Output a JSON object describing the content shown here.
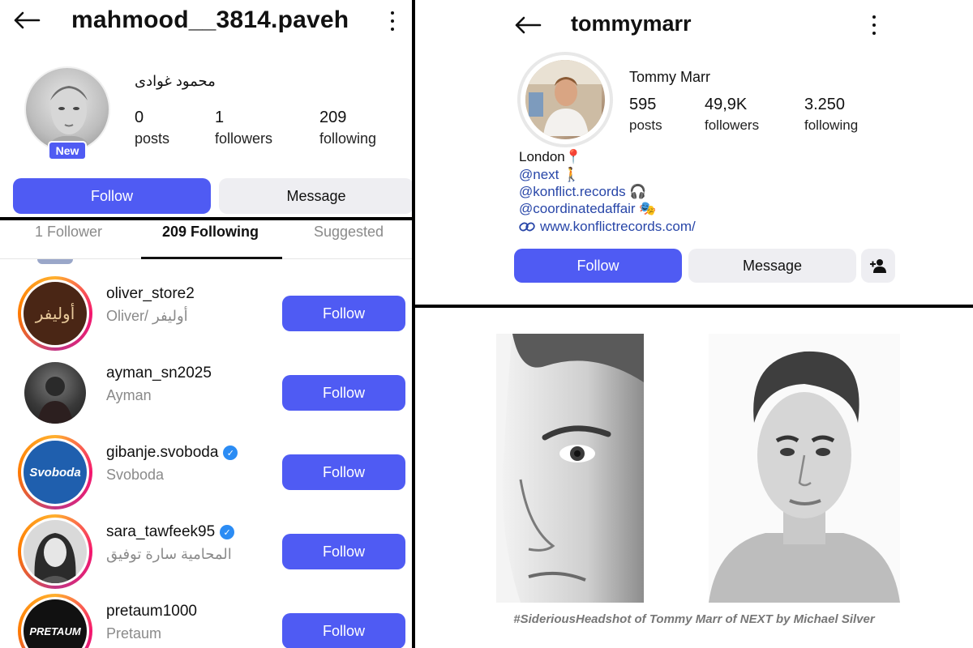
{
  "top_left": {
    "username": "mahmood__3814.paveh",
    "display_name": "محمود غوادی",
    "badge": "New",
    "stats": [
      {
        "value": "0",
        "label": "posts"
      },
      {
        "value": "1",
        "label": "followers"
      },
      {
        "value": "209",
        "label": "following"
      }
    ],
    "follow_label": "Follow",
    "message_label": "Message"
  },
  "bottom_left": {
    "tabs": [
      "1 Follower",
      "209 Following",
      "Suggested"
    ],
    "active_tab": "209 Following",
    "rows": [
      {
        "username": "oliver_store2",
        "subtitle": "Oliver/ أوليفر",
        "verified": false,
        "avatar_text": "أوليفر",
        "button": "Follow"
      },
      {
        "username": "ayman_sn2025",
        "subtitle": "Ayman",
        "verified": false,
        "avatar_text": "",
        "button": "Follow"
      },
      {
        "username": "gibanje.svoboda",
        "subtitle": "Svoboda",
        "verified": true,
        "avatar_text": "Svoboda",
        "button": "Follow"
      },
      {
        "username": "sara_tawfeek95",
        "subtitle": "المحامية سارة توفيق",
        "verified": true,
        "avatar_text": "",
        "button": "Follow"
      },
      {
        "username": "pretaum1000",
        "subtitle": "Pretaum",
        "verified": false,
        "avatar_text": "PRETAUM",
        "button": "Follow"
      }
    ]
  },
  "top_right": {
    "username": "tommymarr",
    "display_name": "Tommy Marr",
    "stats": [
      {
        "value": "595",
        "label": "posts"
      },
      {
        "value": "49,9K",
        "label": "followers"
      },
      {
        "value": "3.250",
        "label": "following"
      }
    ],
    "bio": {
      "location": "London📍",
      "threads_1": "@next 🚶",
      "threads_2": "@konflict.records 🎧",
      "threads_3": "@coordinatedaffair 🎭",
      "website": "www.konflictrecords.com/"
    },
    "follow_label": "Follow",
    "message_label": "Message"
  },
  "bottom_right": {
    "caption": "#SideriousHeadshot of Tommy Marr of NEXT by Michael Silver"
  },
  "colors": {
    "accent": "#4f5bf3",
    "verified": "#2b8cf4",
    "link": "#2846a8",
    "muted": "#8a8a8a"
  },
  "icons": [
    "arrow-left-icon",
    "more-vertical-icon",
    "verified-icon",
    "link-icon",
    "add-person-icon",
    "threads-icon"
  ]
}
